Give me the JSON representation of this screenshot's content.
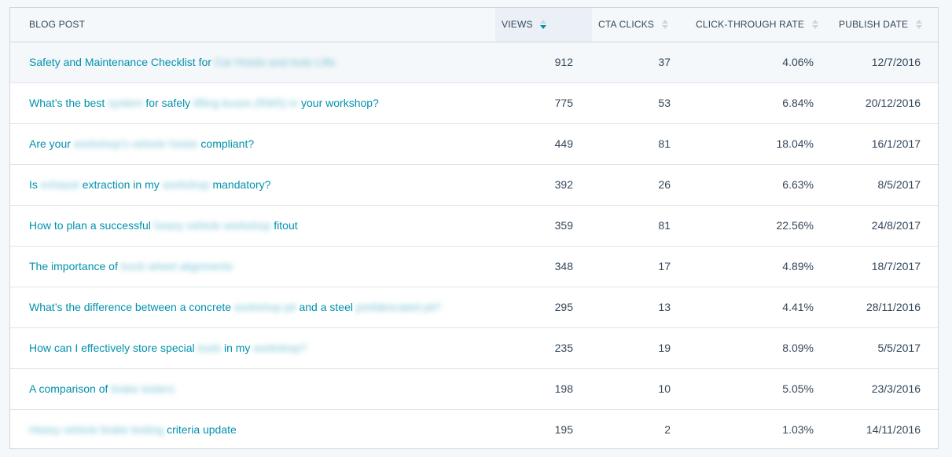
{
  "table": {
    "columns": {
      "post": "BLOG POST",
      "views": "VIEWS",
      "cta": "CTA CLICKS",
      "ctr": "CLICK-THROUGH RATE",
      "date": "PUBLISH DATE"
    },
    "sorted_column": "views",
    "rows": [
      {
        "parts": [
          {
            "t": "Safety and Maintenance Checklist for "
          },
          {
            "t": "Car Hoists and Auto Lifts",
            "blur": true
          }
        ],
        "views": "912",
        "cta": "37",
        "ctr": "4.06%",
        "date": "12/7/2016"
      },
      {
        "parts": [
          {
            "t": "What’s the best "
          },
          {
            "t": "system",
            "blur": true
          },
          {
            "t": " for safely "
          },
          {
            "t": "lifting buses (RMS) in",
            "blur": true
          },
          {
            "t": " your workshop?"
          }
        ],
        "views": "775",
        "cta": "53",
        "ctr": "6.84%",
        "date": "20/12/2016"
      },
      {
        "parts": [
          {
            "t": "Are your "
          },
          {
            "t": "workshop’s vehicle hoists",
            "blur": true
          },
          {
            "t": " compliant?"
          }
        ],
        "views": "449",
        "cta": "81",
        "ctr": "18.04%",
        "date": "16/1/2017"
      },
      {
        "parts": [
          {
            "t": "Is "
          },
          {
            "t": "exhaust",
            "blur": true
          },
          {
            "t": " extraction in my "
          },
          {
            "t": "workshop",
            "blur": true
          },
          {
            "t": " mandatory?"
          }
        ],
        "views": "392",
        "cta": "26",
        "ctr": "6.63%",
        "date": "8/5/2017"
      },
      {
        "parts": [
          {
            "t": "How to plan a successful "
          },
          {
            "t": "heavy vehicle workshop",
            "blur": true
          },
          {
            "t": " fitout"
          }
        ],
        "views": "359",
        "cta": "81",
        "ctr": "22.56%",
        "date": "24/8/2017"
      },
      {
        "parts": [
          {
            "t": "The importance of "
          },
          {
            "t": "truck wheel alignments",
            "blur": true
          }
        ],
        "views": "348",
        "cta": "17",
        "ctr": "4.89%",
        "date": "18/7/2017"
      },
      {
        "parts": [
          {
            "t": "What’s the difference between a concrete "
          },
          {
            "t": "workshop pit",
            "blur": true
          },
          {
            "t": " and a steel "
          },
          {
            "t": "prefabricated pit?",
            "blur": true
          }
        ],
        "views": "295",
        "cta": "13",
        "ctr": "4.41%",
        "date": "28/11/2016"
      },
      {
        "parts": [
          {
            "t": "How can I effectively store special "
          },
          {
            "t": "tools",
            "blur": true
          },
          {
            "t": " in my "
          },
          {
            "t": "workshop?",
            "blur": true
          }
        ],
        "views": "235",
        "cta": "19",
        "ctr": "8.09%",
        "date": "5/5/2017"
      },
      {
        "parts": [
          {
            "t": "A comparison of "
          },
          {
            "t": "brake testers",
            "blur": true
          }
        ],
        "views": "198",
        "cta": "10",
        "ctr": "5.05%",
        "date": "23/3/2016"
      },
      {
        "parts": [
          {
            "t": "Heavy vehicle brake testing",
            "blur": true
          },
          {
            "t": " criteria update"
          }
        ],
        "views": "195",
        "cta": "2",
        "ctr": "1.03%",
        "date": "14/11/2016"
      }
    ]
  },
  "colors": {
    "link": "#0091ae",
    "text": "#33475b",
    "border": "#cbd6e2",
    "header_bg": "#f5f8fa",
    "sorted_header_bg": "#eaf0f6"
  }
}
